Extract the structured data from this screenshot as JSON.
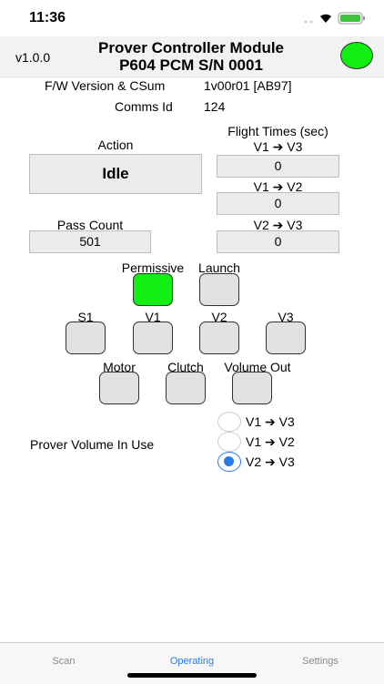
{
  "status_bar": {
    "time": "11:36"
  },
  "header": {
    "version": "v1.0.0",
    "title_line1": "Prover Controller Module",
    "title_line2": "P604 PCM S/N 0001",
    "connection_color": "#11ee11"
  },
  "info": {
    "fw_label": "F/W Version & CSum",
    "fw_value": "1v00r01 [AB97]",
    "comms_label": "Comms Id",
    "comms_value": "124"
  },
  "action": {
    "label": "Action",
    "value": "Idle"
  },
  "pass_count": {
    "label": "Pass Count",
    "value": "501"
  },
  "flight_times": {
    "title": "Flight Times (sec)",
    "items": [
      {
        "label": "V1 ➔ V3",
        "value": "0"
      },
      {
        "label": "V1 ➔ V2",
        "value": "0"
      },
      {
        "label": "V2 ➔ V3",
        "value": "0"
      }
    ]
  },
  "indicators": {
    "permissive": {
      "label": "Permissive",
      "on": true
    },
    "launch": {
      "label": "Launch",
      "on": false
    },
    "s1": {
      "label": "S1",
      "on": false
    },
    "v1": {
      "label": "V1",
      "on": false
    },
    "v2": {
      "label": "V2",
      "on": false
    },
    "v3": {
      "label": "V3",
      "on": false
    },
    "motor": {
      "label": "Motor",
      "on": false
    },
    "clutch": {
      "label": "Clutch",
      "on": false
    },
    "volume_out": {
      "label": "Volume Out",
      "on": false
    }
  },
  "prover_volume": {
    "label": "Prover Volume In Use",
    "options": [
      "V1 ➔ V3",
      "V1 ➔ V2",
      "V2 ➔ V3"
    ],
    "selected": "V2 ➔ V3"
  },
  "tabs": [
    {
      "label": "Scan"
    },
    {
      "label": "Operating",
      "active": true
    },
    {
      "label": "Settings"
    }
  ]
}
